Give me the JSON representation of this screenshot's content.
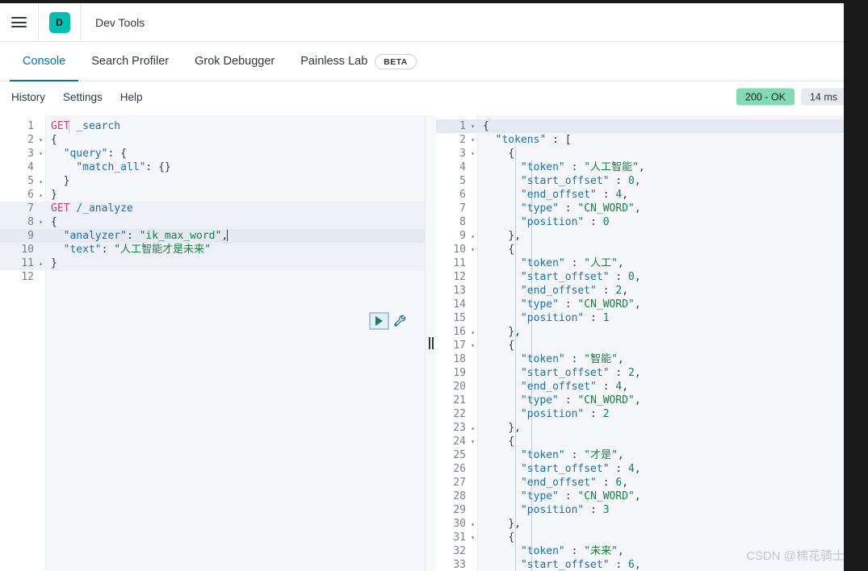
{
  "chrome": {
    "menu_icon": "hamburger-icon",
    "logo_letter": "D",
    "app_title": "Dev Tools"
  },
  "tabs": [
    {
      "label": "Console",
      "active": true
    },
    {
      "label": "Search Profiler",
      "active": false
    },
    {
      "label": "Grok Debugger",
      "active": false
    },
    {
      "label": "Painless Lab",
      "active": false,
      "badge": "BETA"
    }
  ],
  "subbar": {
    "items": [
      "History",
      "Settings",
      "Help"
    ],
    "status_code": "200 - OK",
    "duration": "14 ms"
  },
  "colors": {
    "accent": "#0071c2",
    "logo": "#00bfb3",
    "status_ok_bg": "#7fddb6",
    "duration_bg": "#e6e9f0",
    "method": "#d5387c",
    "string": "#17803d",
    "key": "#1a70b8",
    "number": "#0f7b7b"
  },
  "editor": {
    "cursor_line": 9,
    "highlight_range": [
      7,
      11
    ],
    "lines": [
      {
        "n": 1,
        "fold": "",
        "text": "GET _search"
      },
      {
        "n": 2,
        "fold": "▾",
        "text": "{"
      },
      {
        "n": 3,
        "fold": "▾",
        "text": "  \"query\": {"
      },
      {
        "n": 4,
        "fold": "",
        "text": "    \"match_all\": {}"
      },
      {
        "n": 5,
        "fold": "▴",
        "text": "  }"
      },
      {
        "n": 6,
        "fold": "▴",
        "text": "}"
      },
      {
        "n": 7,
        "fold": "",
        "text": "GET /_analyze"
      },
      {
        "n": 8,
        "fold": "▾",
        "text": "{"
      },
      {
        "n": 9,
        "fold": "",
        "text": "  \"analyzer\": \"ik_max_word\","
      },
      {
        "n": 10,
        "fold": "",
        "text": "  \"text\": \"人工智能才是未来\""
      },
      {
        "n": 11,
        "fold": "▴",
        "text": "}"
      },
      {
        "n": 12,
        "fold": "",
        "text": ""
      }
    ],
    "actions": {
      "play": "play-icon",
      "wrench": "wrench-icon"
    }
  },
  "response": {
    "lines": [
      {
        "n": 1,
        "fold": "▾",
        "text": "{"
      },
      {
        "n": 2,
        "fold": "▾",
        "text": "  \"tokens\" : ["
      },
      {
        "n": 3,
        "fold": "▾",
        "text": "    {"
      },
      {
        "n": 4,
        "fold": "",
        "text": "      \"token\" : \"人工智能\","
      },
      {
        "n": 5,
        "fold": "",
        "text": "      \"start_offset\" : 0,"
      },
      {
        "n": 6,
        "fold": "",
        "text": "      \"end_offset\" : 4,"
      },
      {
        "n": 7,
        "fold": "",
        "text": "      \"type\" : \"CN_WORD\","
      },
      {
        "n": 8,
        "fold": "",
        "text": "      \"position\" : 0"
      },
      {
        "n": 9,
        "fold": "▴",
        "text": "    },"
      },
      {
        "n": 10,
        "fold": "▾",
        "text": "    {"
      },
      {
        "n": 11,
        "fold": "",
        "text": "      \"token\" : \"人工\","
      },
      {
        "n": 12,
        "fold": "",
        "text": "      \"start_offset\" : 0,"
      },
      {
        "n": 13,
        "fold": "",
        "text": "      \"end_offset\" : 2,"
      },
      {
        "n": 14,
        "fold": "",
        "text": "      \"type\" : \"CN_WORD\","
      },
      {
        "n": 15,
        "fold": "",
        "text": "      \"position\" : 1"
      },
      {
        "n": 16,
        "fold": "▴",
        "text": "    },"
      },
      {
        "n": 17,
        "fold": "▾",
        "text": "    {"
      },
      {
        "n": 18,
        "fold": "",
        "text": "      \"token\" : \"智能\","
      },
      {
        "n": 19,
        "fold": "",
        "text": "      \"start_offset\" : 2,"
      },
      {
        "n": 20,
        "fold": "",
        "text": "      \"end_offset\" : 4,"
      },
      {
        "n": 21,
        "fold": "",
        "text": "      \"type\" : \"CN_WORD\","
      },
      {
        "n": 22,
        "fold": "",
        "text": "      \"position\" : 2"
      },
      {
        "n": 23,
        "fold": "▴",
        "text": "    },"
      },
      {
        "n": 24,
        "fold": "▾",
        "text": "    {"
      },
      {
        "n": 25,
        "fold": "",
        "text": "      \"token\" : \"才是\","
      },
      {
        "n": 26,
        "fold": "",
        "text": "      \"start_offset\" : 4,"
      },
      {
        "n": 27,
        "fold": "",
        "text": "      \"end_offset\" : 6,"
      },
      {
        "n": 28,
        "fold": "",
        "text": "      \"type\" : \"CN_WORD\","
      },
      {
        "n": 29,
        "fold": "",
        "text": "      \"position\" : 3"
      },
      {
        "n": 30,
        "fold": "▴",
        "text": "    },"
      },
      {
        "n": 31,
        "fold": "▾",
        "text": "    {"
      },
      {
        "n": 32,
        "fold": "",
        "text": "      \"token\" : \"未来\","
      },
      {
        "n": 33,
        "fold": "",
        "text": "      \"start_offset\" : 6,"
      }
    ]
  },
  "watermark": "CSDN @棉花骑士"
}
